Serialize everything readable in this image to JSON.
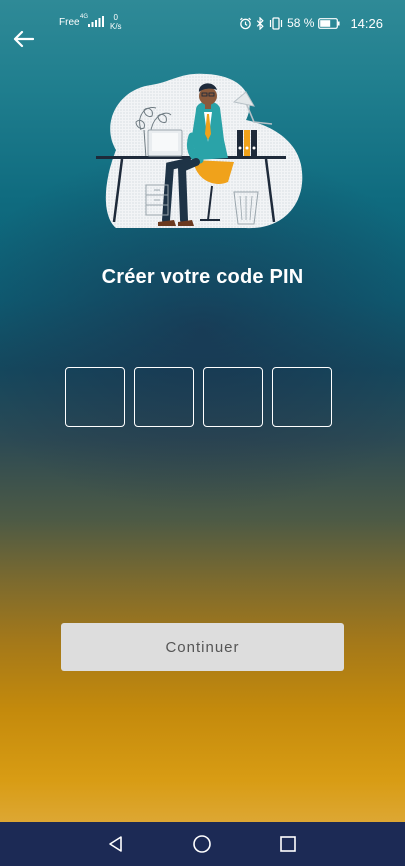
{
  "status_bar": {
    "carrier": "Free",
    "network_type": "4G",
    "net_speed_value": "0",
    "net_speed_unit": "K/s",
    "battery_percent": "58 %",
    "time": "14:26"
  },
  "header": {
    "back_icon": "arrow-left-icon"
  },
  "illustration": {
    "icon": "person-at-desk-illustration"
  },
  "main": {
    "title": "Créer votre code PIN",
    "pin_digits": [
      "",
      "",
      "",
      ""
    ]
  },
  "actions": {
    "continue_label": "Continuer"
  },
  "nav_bar": {
    "back_icon": "triangle-back-icon",
    "home_icon": "circle-home-icon",
    "recents_icon": "square-recents-icon"
  },
  "colors": {
    "gradient_top": "#2f8a97",
    "gradient_mid": "#144a5f",
    "gradient_bottom": "#d89c14",
    "button_bg": "#dddddd",
    "button_text": "#555555",
    "nav_bar_bg": "#1c2a55"
  }
}
